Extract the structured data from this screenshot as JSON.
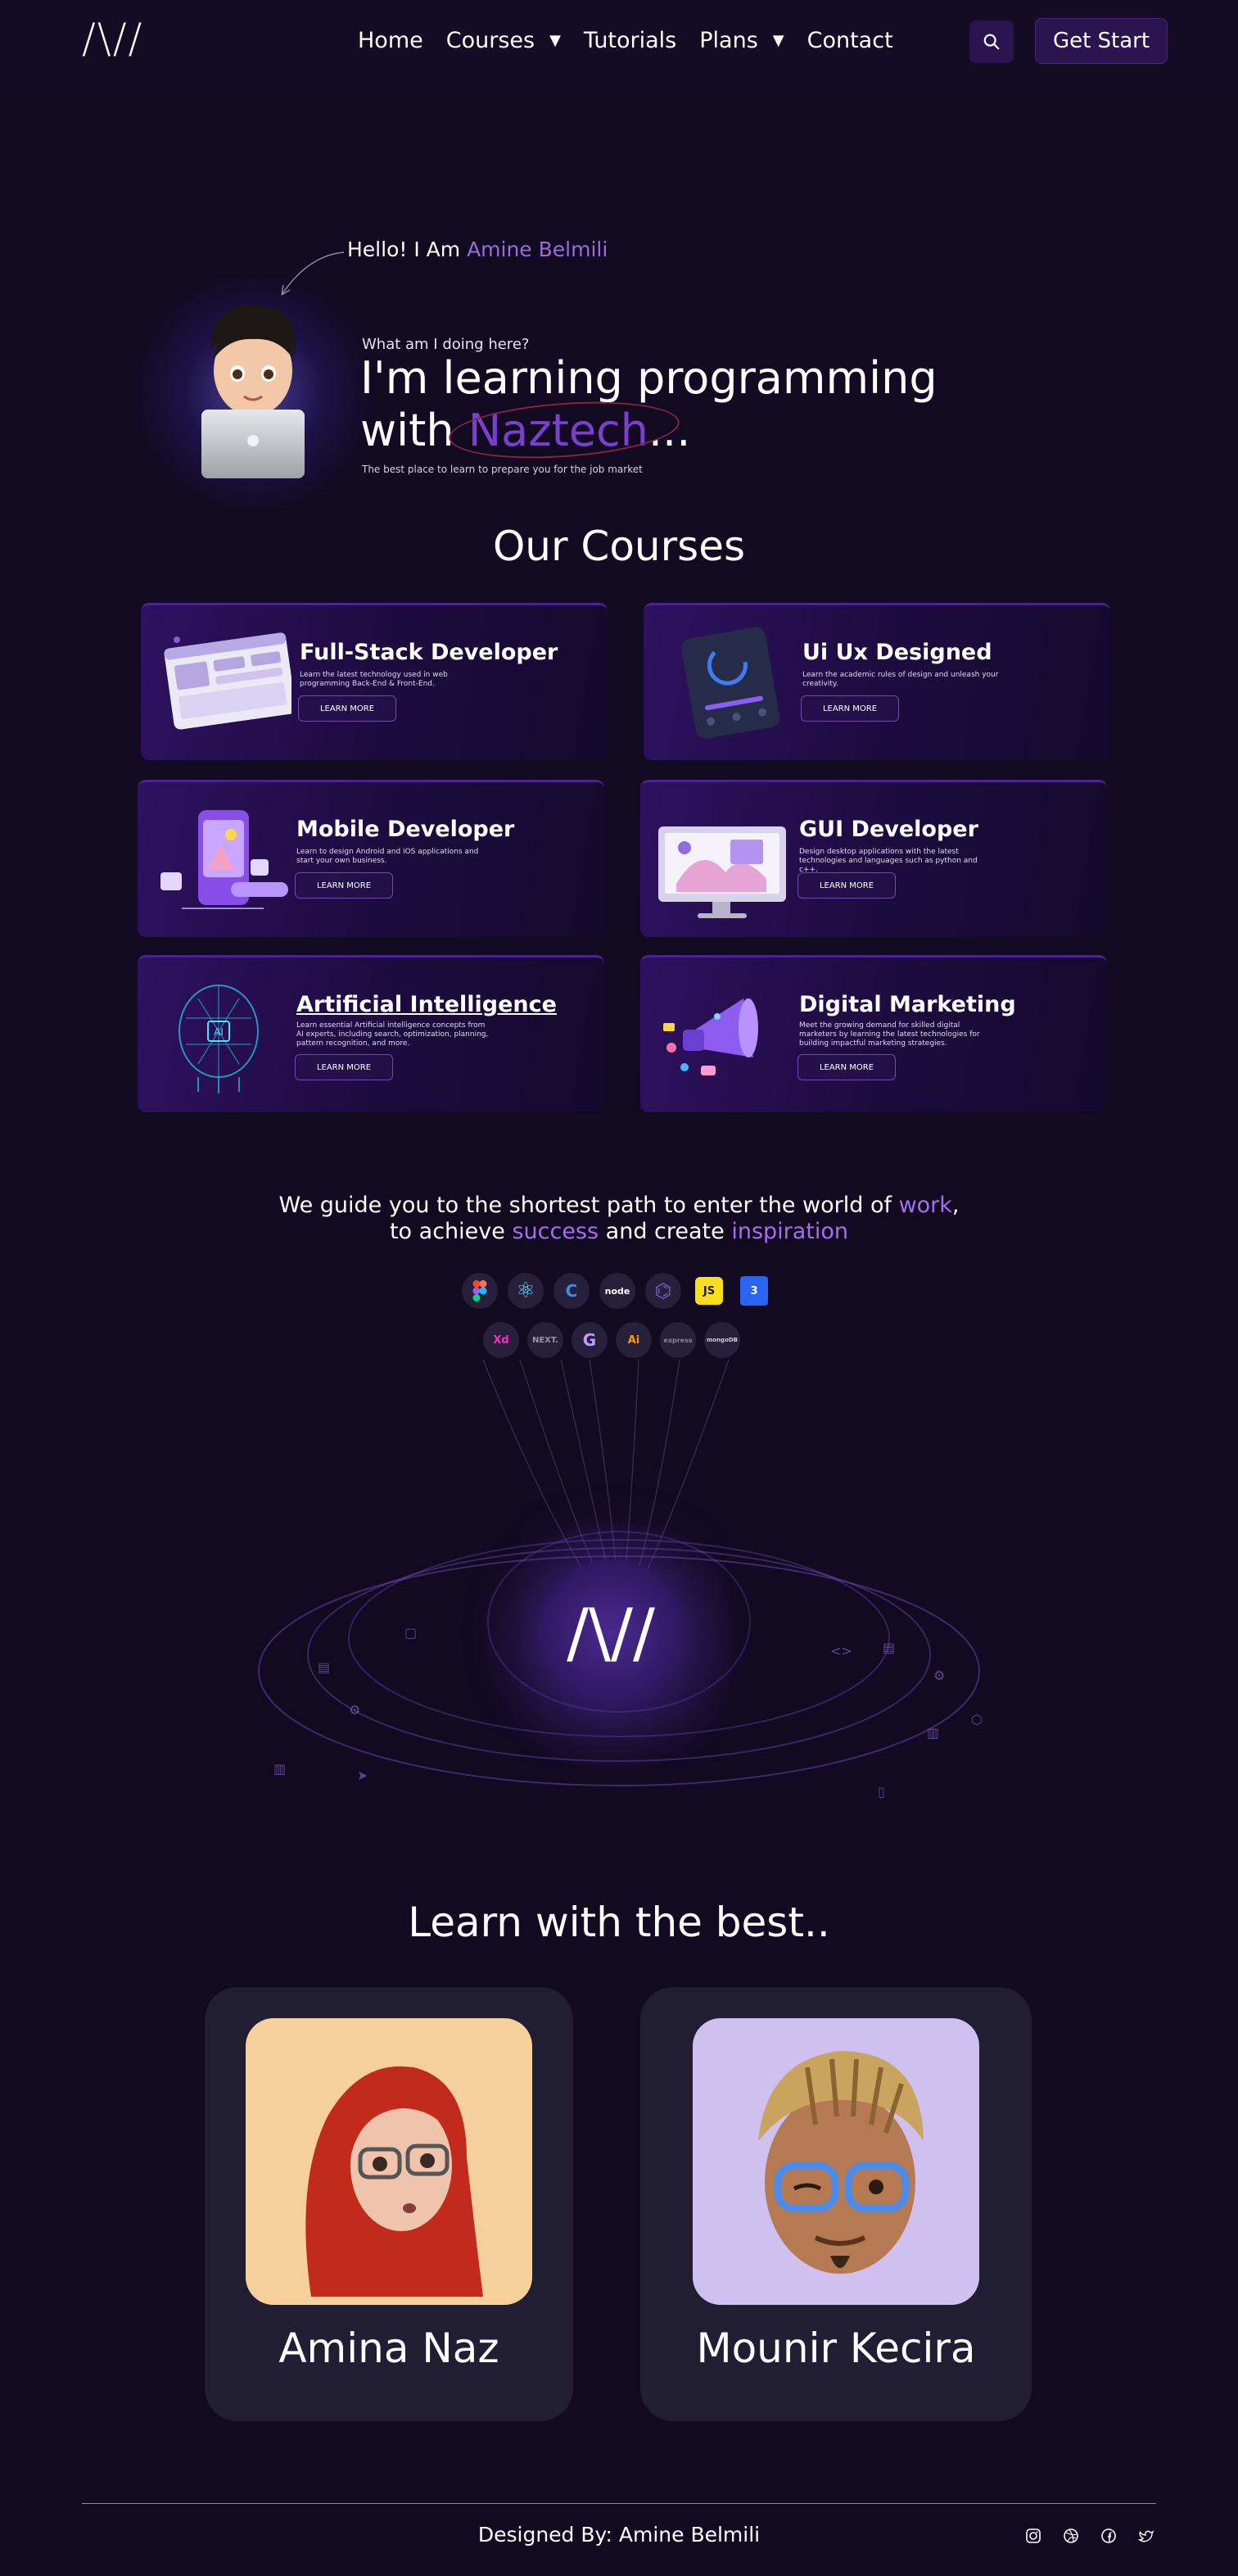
{
  "nav": {
    "logo": "/\\//",
    "items": [
      {
        "label": "Home",
        "has_dropdown": false
      },
      {
        "label": "Courses",
        "has_dropdown": true
      },
      {
        "label": "Tutorials",
        "has_dropdown": false
      },
      {
        "label": "Plans",
        "has_dropdown": true
      },
      {
        "label": "Contact",
        "has_dropdown": false
      }
    ],
    "caret": "▼",
    "cta": "Get Start"
  },
  "hero": {
    "hello_prefix": "Hello! I Am ",
    "hello_name": "Amine Belmili",
    "subtitle": "What am I doing here?",
    "title_line1": "I'm learning programming",
    "title_with": "with ",
    "title_brand": "Naztech",
    "title_ellipsis": "...",
    "description": "The best place to learn to prepare you for the job market"
  },
  "courses": {
    "title": "Our Courses",
    "button_label": "LEARN MORE",
    "items": [
      {
        "title": "Full-Stack Developer",
        "desc": "Learn the latest technology used in web programming Back-End & Front-End."
      },
      {
        "title": "Ui Ux Designed",
        "desc": "Learn the academic rules of design and unleash your creativity."
      },
      {
        "title": "Mobile Developer",
        "desc": "Learn to design Android and iOS applications and start your own business."
      },
      {
        "title": "GUI Developer",
        "desc": "Design desktop applications with the latest technologies and languages such as python and c++."
      },
      {
        "title": "Artificial Intelligence",
        "desc": "Learn essential Artificial intelligence concepts from AI experts, including search, optimization, planning, pattern recognition, and more."
      },
      {
        "title": "Digital Marketing",
        "desc": "Meet the growing demand for skilled digital marketers by learning the latest technologies for building impactful marketing strategies."
      }
    ]
  },
  "guide": {
    "line1_a": "We guide you to the shortest path to enter the world of ",
    "line1_accent": "work",
    "line1_end": ",",
    "line2_a": "to achieve ",
    "line2_accent1": "success",
    "line2_b": " and create ",
    "line2_accent2": "inspiration"
  },
  "tech_row1": [
    {
      "icon": "figma-icon",
      "label": "",
      "color": "#f24e1e"
    },
    {
      "icon": "react-icon",
      "label": "⚛",
      "color": "#61dafb"
    },
    {
      "icon": "c-lang-icon",
      "label": "C",
      "color": "#3c8ee0"
    },
    {
      "icon": "node-icon",
      "label": "node",
      "color": "#ffffff"
    },
    {
      "icon": "redux-icon",
      "label": "⌬",
      "color": "#7a5bc4"
    },
    {
      "icon": "javascript-icon",
      "label": "JS",
      "color": "#f7df1e"
    },
    {
      "icon": "css3-icon",
      "label": "3",
      "color": "#2965f1"
    }
  ],
  "tech_row2": [
    {
      "icon": "adobe-xd-icon",
      "label": "Xd",
      "color": "#ff2bc2"
    },
    {
      "icon": "nextjs-icon",
      "label": "NEXT.",
      "color": "#9a96a6"
    },
    {
      "icon": "gatsby-icon",
      "label": "G",
      "color": "#c39bff"
    },
    {
      "icon": "illustrator-icon",
      "label": "Ai",
      "color": "#ff9a00"
    },
    {
      "icon": "express-icon",
      "label": "express",
      "color": "#8a8698"
    },
    {
      "icon": "mongodb-icon",
      "label": "mongoDB",
      "color": "#cfcfd8"
    }
  ],
  "orbit": {
    "center_logo": "/\\//"
  },
  "instructors": {
    "title": "Learn with the best..",
    "people": [
      {
        "name": "Amina Naz",
        "bg": "#f5d09b"
      },
      {
        "name": "Mounir Kecira",
        "bg": "#cfc0ef"
      }
    ]
  },
  "footer": {
    "credit": "Designed By: Amine Belmili",
    "socials": [
      "instagram-icon",
      "dribbble-icon",
      "facebook-icon",
      "twitter-icon"
    ]
  }
}
